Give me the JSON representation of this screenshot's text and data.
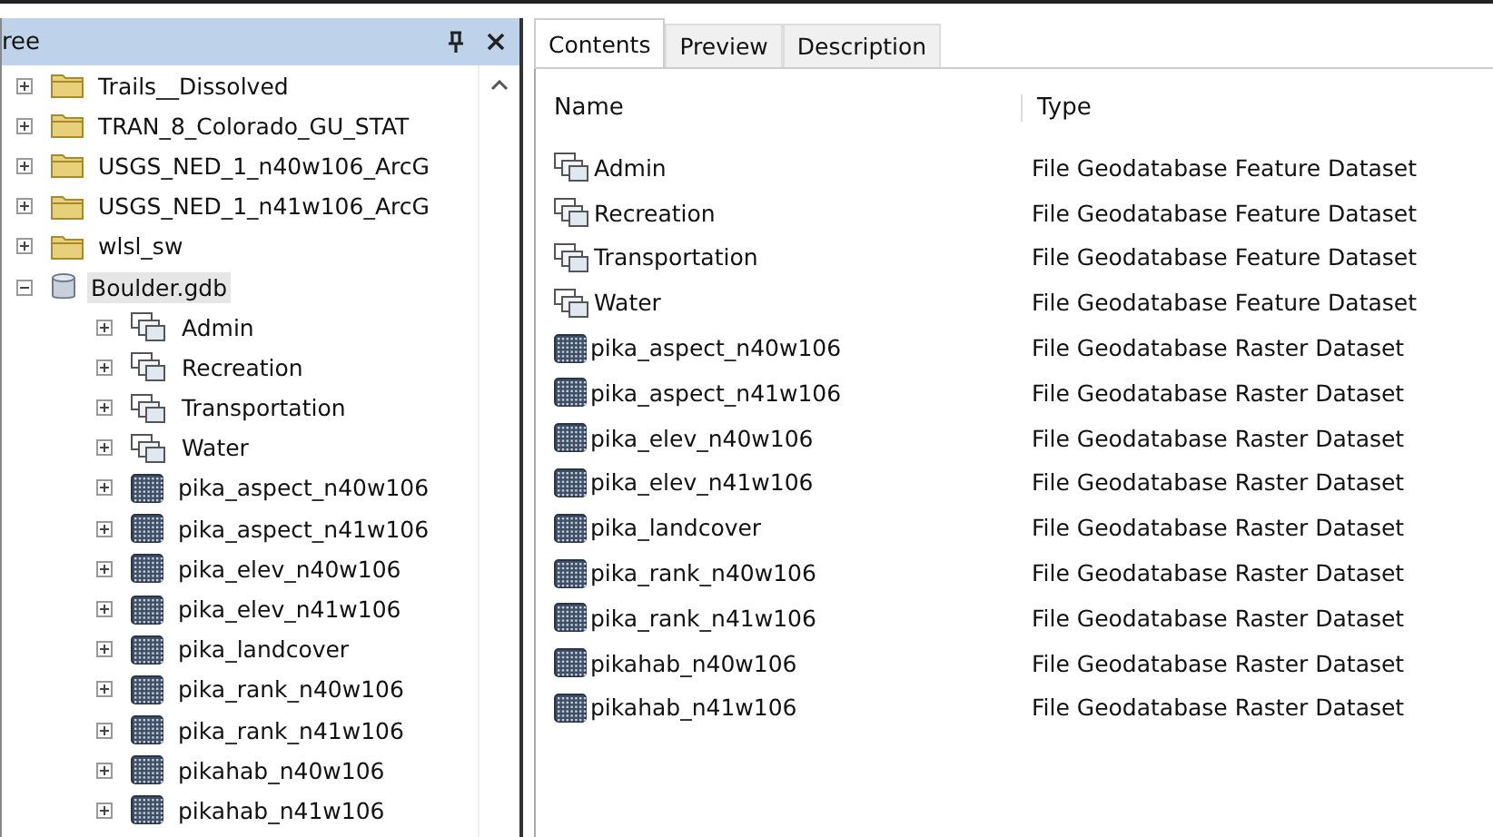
{
  "tree_panel": {
    "title": "ree",
    "items": [
      {
        "label": "Trails__Dissolved",
        "kind": "folder",
        "expanded": false,
        "selected": false
      },
      {
        "label": "TRAN_8_Colorado_GU_STAT",
        "kind": "folder",
        "expanded": false,
        "selected": false
      },
      {
        "label": "USGS_NED_1_n40w106_ArcG",
        "kind": "folder",
        "expanded": false,
        "selected": false
      },
      {
        "label": "USGS_NED_1_n41w106_ArcG",
        "kind": "folder",
        "expanded": false,
        "selected": false
      },
      {
        "label": "wlsl_sw",
        "kind": "folder",
        "expanded": false,
        "selected": false
      },
      {
        "label": "Boulder.gdb",
        "kind": "gdb",
        "expanded": true,
        "selected": true,
        "children": [
          {
            "label": "Admin",
            "kind": "feature-dataset",
            "expanded": false,
            "selected": false
          },
          {
            "label": "Recreation",
            "kind": "feature-dataset",
            "expanded": false,
            "selected": false
          },
          {
            "label": "Transportation",
            "kind": "feature-dataset",
            "expanded": false,
            "selected": false
          },
          {
            "label": "Water",
            "kind": "feature-dataset",
            "expanded": false,
            "selected": false
          },
          {
            "label": "pika_aspect_n40w106",
            "kind": "raster",
            "expanded": false,
            "selected": false
          },
          {
            "label": "pika_aspect_n41w106",
            "kind": "raster",
            "expanded": false,
            "selected": false
          },
          {
            "label": "pika_elev_n40w106",
            "kind": "raster",
            "expanded": false,
            "selected": false
          },
          {
            "label": "pika_elev_n41w106",
            "kind": "raster",
            "expanded": false,
            "selected": false
          },
          {
            "label": "pika_landcover",
            "kind": "raster",
            "expanded": false,
            "selected": false
          },
          {
            "label": "pika_rank_n40w106",
            "kind": "raster",
            "expanded": false,
            "selected": false
          },
          {
            "label": "pika_rank_n41w106",
            "kind": "raster",
            "expanded": false,
            "selected": false
          },
          {
            "label": "pikahab_n40w106",
            "kind": "raster",
            "expanded": false,
            "selected": false
          },
          {
            "label": "pikahab_n41w106",
            "kind": "raster",
            "expanded": false,
            "selected": false
          }
        ]
      }
    ]
  },
  "tabs": [
    {
      "label": "Contents",
      "selected": true
    },
    {
      "label": "Preview",
      "selected": false
    },
    {
      "label": "Description",
      "selected": false
    }
  ],
  "table": {
    "columns": [
      "Name",
      "Type"
    ],
    "rows": [
      {
        "name": "Admin",
        "kind": "feature-dataset",
        "type": "File Geodatabase Feature Dataset"
      },
      {
        "name": "Recreation",
        "kind": "feature-dataset",
        "type": "File Geodatabase Feature Dataset"
      },
      {
        "name": "Transportation",
        "kind": "feature-dataset",
        "type": "File Geodatabase Feature Dataset"
      },
      {
        "name": "Water",
        "kind": "feature-dataset",
        "type": "File Geodatabase Feature Dataset"
      },
      {
        "name": "pika_aspect_n40w106",
        "kind": "raster",
        "type": "File Geodatabase Raster Dataset"
      },
      {
        "name": "pika_aspect_n41w106",
        "kind": "raster",
        "type": "File Geodatabase Raster Dataset"
      },
      {
        "name": "pika_elev_n40w106",
        "kind": "raster",
        "type": "File Geodatabase Raster Dataset"
      },
      {
        "name": "pika_elev_n41w106",
        "kind": "raster",
        "type": "File Geodatabase Raster Dataset"
      },
      {
        "name": "pika_landcover",
        "kind": "raster",
        "type": "File Geodatabase Raster Dataset"
      },
      {
        "name": "pika_rank_n40w106",
        "kind": "raster",
        "type": "File Geodatabase Raster Dataset"
      },
      {
        "name": "pika_rank_n41w106",
        "kind": "raster",
        "type": "File Geodatabase Raster Dataset"
      },
      {
        "name": "pikahab_n40w106",
        "kind": "raster",
        "type": "File Geodatabase Raster Dataset"
      },
      {
        "name": "pikahab_n41w106",
        "kind": "raster",
        "type": "File Geodatabase Raster Dataset"
      }
    ]
  }
}
